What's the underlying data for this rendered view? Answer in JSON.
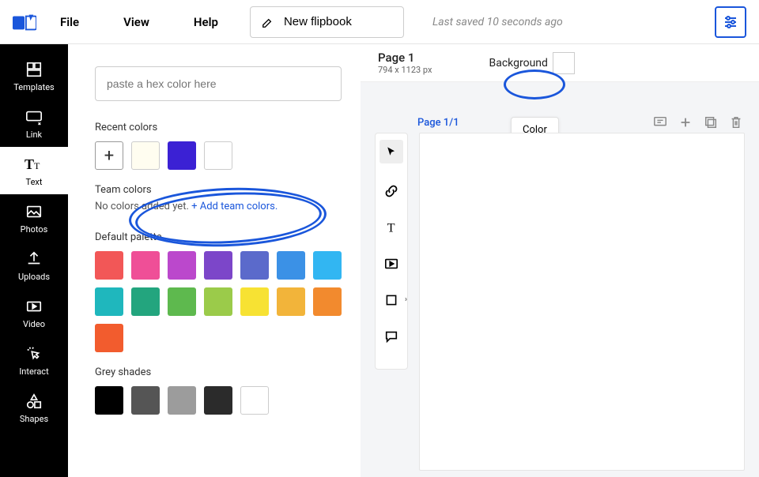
{
  "topbar": {
    "menu": {
      "file": "File",
      "view": "View",
      "help": "Help"
    },
    "title_value": "New flipbook",
    "last_saved": "Last saved 10 seconds ago"
  },
  "sidebar": {
    "items": [
      {
        "id": "templates",
        "label": "Templates"
      },
      {
        "id": "link",
        "label": "Link"
      },
      {
        "id": "text",
        "label": "Text"
      },
      {
        "id": "photos",
        "label": "Photos"
      },
      {
        "id": "uploads",
        "label": "Uploads"
      },
      {
        "id": "video",
        "label": "Video"
      },
      {
        "id": "interact",
        "label": "Interact"
      },
      {
        "id": "shapes",
        "label": "Shapes"
      }
    ],
    "active": "text"
  },
  "color_panel": {
    "hex_placeholder": "paste a hex color here",
    "recent_label": "Recent colors",
    "recent": [
      "#fffdf0",
      "#3b21d4",
      "#ffffff"
    ],
    "team_label": "Team colors",
    "team_empty_text": "No colors added yet. ",
    "team_add_link": "+ Add team colors.",
    "default_label": "Default palette",
    "default": [
      "#f25757",
      "#ef4f97",
      "#bb48cc",
      "#7c46c9",
      "#5b6acb",
      "#3b91e6",
      "#32b6f2",
      "#1fb7bd",
      "#23a57e",
      "#5eb94e",
      "#9bcb4a",
      "#f7e233",
      "#f2b43a",
      "#f28a2e",
      "#f25c2e"
    ],
    "grey_label": "Grey shades",
    "greys": [
      "#000000",
      "#555555",
      "#9c9c9c",
      "#2b2b2b",
      "#ffffff"
    ]
  },
  "page_header": {
    "page_label": "Page 1",
    "dimensions": "794 x 1123 px",
    "background_label": "Background",
    "background_color": "#ffffff",
    "tooltip": "Color"
  },
  "canvas": {
    "page_counter": "Page 1/1"
  }
}
